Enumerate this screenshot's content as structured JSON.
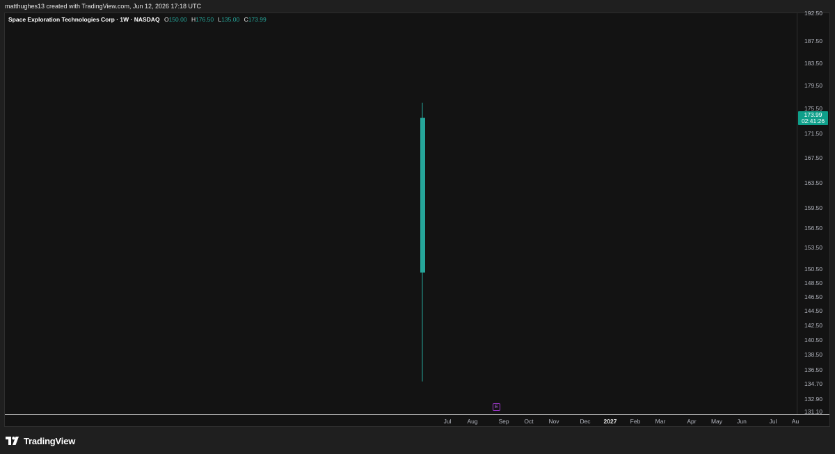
{
  "header": {
    "credit": "matthughes13 created with TradingView.com, Jun 12, 2026 17:18 UTC"
  },
  "legend": {
    "symbol": "Space Exploration Technologies Corp · 1W · NASDAQ",
    "open_label": "O",
    "open": "150.00",
    "high_label": "H",
    "high": "176.50",
    "low_label": "L",
    "low": "135.00",
    "close_label": "C",
    "close": "173.99"
  },
  "price_axis": {
    "ticks": [
      "192.50",
      "187.50",
      "183.50",
      "179.50",
      "175.50",
      "171.50",
      "167.50",
      "163.50",
      "159.50",
      "156.50",
      "153.50",
      "150.50",
      "148.50",
      "146.50",
      "144.50",
      "142.50",
      "140.50",
      "138.50",
      "136.50",
      "134.70",
      "132.90",
      "131.10"
    ]
  },
  "last_price": {
    "price": "173.99",
    "countdown": "02:41:26"
  },
  "time_axis": {
    "ticks": [
      {
        "label": "Jul",
        "bold": false
      },
      {
        "label": "Aug",
        "bold": false
      },
      {
        "label": "Sep",
        "bold": false
      },
      {
        "label": "Oct",
        "bold": false
      },
      {
        "label": "Nov",
        "bold": false
      },
      {
        "label": "Dec",
        "bold": false
      },
      {
        "label": "2027",
        "bold": true
      },
      {
        "label": "Feb",
        "bold": false
      },
      {
        "label": "Mar",
        "bold": false
      },
      {
        "label": "Apr",
        "bold": false
      },
      {
        "label": "May",
        "bold": false
      },
      {
        "label": "Jun",
        "bold": false
      },
      {
        "label": "Jul",
        "bold": false
      },
      {
        "label": "Au",
        "bold": false
      }
    ]
  },
  "events": {
    "earnings_label": "E"
  },
  "candle": {
    "open": 150.0,
    "high": 176.5,
    "low": 135.0,
    "close": 173.99,
    "color": "#26a69a"
  },
  "colors": {
    "up": "#26a69a",
    "badge": "#0f9f8a",
    "earnings": "#9b35c9"
  },
  "footer": {
    "brand": "TradingView",
    "logo_icon": "tradingview-logo-icon"
  }
}
